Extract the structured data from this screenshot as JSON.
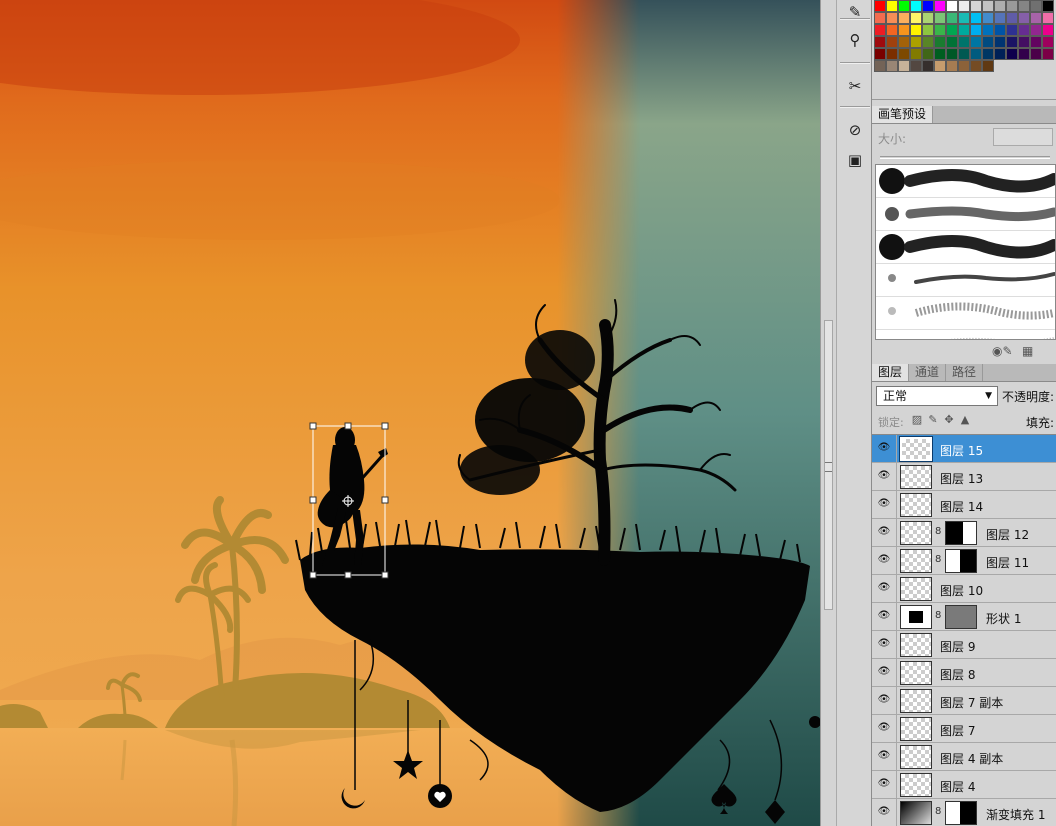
{
  "app": {
    "swatch_colors": [
      "#ff0000",
      "#ffff00",
      "#00ff00",
      "#00ffff",
      "#0000ff",
      "#ff00ff",
      "#ffffff",
      "#ebebeb",
      "#d6d6d6",
      "#c2c2c2",
      "#adadad",
      "#999999",
      "#858585",
      "#707070",
      "#000000",
      "#f26c4f",
      "#f68e56",
      "#fbaf5d",
      "#fff568",
      "#acd372",
      "#7cc576",
      "#3bb878",
      "#1abbb4",
      "#00bff3",
      "#438ccb",
      "#5574b9",
      "#605ca8",
      "#855fa8",
      "#a763a8",
      "#f06ea9",
      "#ed1c24",
      "#f26522",
      "#f7941d",
      "#fff200",
      "#8dc63f",
      "#39b54a",
      "#00a651",
      "#00a99d",
      "#00aeef",
      "#0072bc",
      "#0054a6",
      "#2e3192",
      "#662d91",
      "#92278f",
      "#ec008c",
      "#9e0b0f",
      "#a0410d",
      "#a36209",
      "#aba000",
      "#598527",
      "#1a7b30",
      "#007236",
      "#00746b",
      "#0076a3",
      "#004b80",
      "#003471",
      "#1b1464",
      "#440e62",
      "#630460",
      "#9e005d",
      "#790000",
      "#7b2e00",
      "#7d4900",
      "#827b00",
      "#406618",
      "#005e20",
      "#005826",
      "#005952",
      "#005b7f",
      "#003663",
      "#002157",
      "#0d004c",
      "#32004b",
      "#4b0049",
      "#7b0046",
      "#736357",
      "#998675",
      "#c7b299",
      "#534741",
      "#362f2d",
      "#c69c6d",
      "#a67c52",
      "#8c6239",
      "#754c24",
      "#603913"
    ],
    "tools": [
      {
        "icon": "eyedropper-icon",
        "glyph": "✎"
      },
      {
        "icon": "usb-brush-icon",
        "glyph": "⚲"
      },
      {
        "icon": "tools-icon",
        "glyph": "✂"
      },
      {
        "icon": "stamp-icon",
        "glyph": "⊘"
      },
      {
        "icon": "camera-icon",
        "glyph": "▣"
      }
    ],
    "brush_panel": {
      "tab": "画笔预设",
      "size_label": "大小:"
    },
    "layers_panel": {
      "tabs": [
        "图层",
        "通道",
        "路径"
      ],
      "blend_mode": "正常",
      "opacity_label": "不透明度:",
      "lock_label": "锁定:",
      "fill_label": "填充:",
      "layers": [
        {
          "name": "图层 15",
          "selected": true,
          "thumb": "checker",
          "mask": ""
        },
        {
          "name": "图层 13",
          "selected": false,
          "thumb": "checker",
          "mask": ""
        },
        {
          "name": "图层 14",
          "selected": false,
          "thumb": "checker",
          "mask": ""
        },
        {
          "name": "图层 12",
          "selected": false,
          "thumb": "checker",
          "mask": "dark-left"
        },
        {
          "name": "图层 11",
          "selected": false,
          "thumb": "checker",
          "mask": "dark-right"
        },
        {
          "name": "图层 10",
          "selected": false,
          "thumb": "checker",
          "mask": ""
        },
        {
          "name": "形状 1",
          "selected": false,
          "thumb": "fill-black",
          "mask": "shape-gray"
        },
        {
          "name": "图层 9",
          "selected": false,
          "thumb": "checker",
          "mask": ""
        },
        {
          "name": "图层 8",
          "selected": false,
          "thumb": "checker",
          "mask": ""
        },
        {
          "name": "图层 7 副本",
          "selected": false,
          "thumb": "checker",
          "mask": ""
        },
        {
          "name": "图层 7",
          "selected": false,
          "thumb": "checker",
          "mask": ""
        },
        {
          "name": "图层 4 副本",
          "selected": false,
          "thumb": "checker",
          "mask": ""
        },
        {
          "name": "图层 4",
          "selected": false,
          "thumb": "checker",
          "mask": ""
        },
        {
          "name": "渐变填充 1",
          "selected": false,
          "thumb": "grad",
          "mask": "dark-right"
        }
      ]
    },
    "colors": {
      "selection_blue": "#3d8fd4",
      "sky_orange": "#e8922a",
      "sky_teal": "#5f8f86"
    }
  }
}
